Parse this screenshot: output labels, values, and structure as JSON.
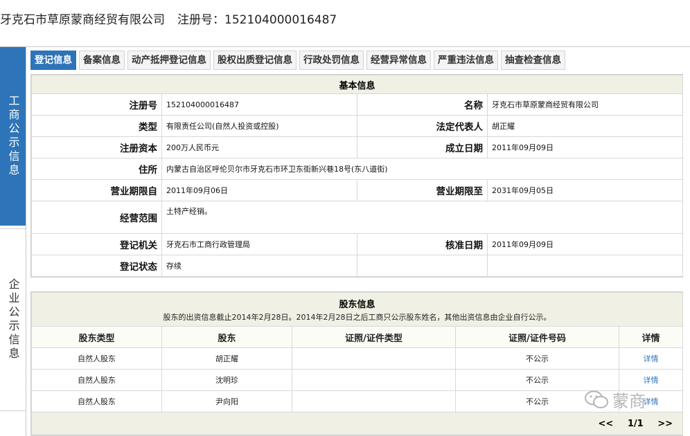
{
  "header": {
    "company": "牙克石市草原蒙商经贸有限公司",
    "reg_label": "注册号：",
    "reg_number": "152104000016487"
  },
  "side_tabs": [
    {
      "label": "工商公示信息",
      "active": true
    },
    {
      "label": "企业公示信息",
      "active": false
    }
  ],
  "tabs": [
    {
      "label": "登记信息",
      "active": true
    },
    {
      "label": "备案信息"
    },
    {
      "label": "动产抵押登记信息"
    },
    {
      "label": "股权出质登记信息"
    },
    {
      "label": "行政处罚信息"
    },
    {
      "label": "经营异常信息"
    },
    {
      "label": "严重违法信息"
    },
    {
      "label": "抽查检查信息"
    }
  ],
  "basic": {
    "title": "基本信息",
    "reg_no_label": "注册号",
    "reg_no": "152104000016487",
    "name_label": "名称",
    "name": "牙克石市草原蒙商经贸有限公司",
    "type_label": "类型",
    "type": "有限责任公司(自然人投资或控股)",
    "legal_label": "法定代表人",
    "legal": "胡正耀",
    "capital_label": "注册资本",
    "capital": "200万人民币元",
    "established_label": "成立日期",
    "established": "2011年09月09日",
    "address_label": "住所",
    "address": "内蒙古自治区呼伦贝尔市牙克石市环卫东街新兴巷18号(东八道街)",
    "from_label": "营业期限自",
    "from": "2011年09月06日",
    "to_label": "营业期限至",
    "to": "2031年09月05日",
    "scope_label": "经营范围",
    "scope": "土特产经销。",
    "authority_label": "登记机关",
    "authority": "牙克石市工商行政管理局",
    "approval_label": "核准日期",
    "approval": "2011年09月09日",
    "status_label": "登记状态",
    "status": "存续"
  },
  "shareholders": {
    "title": "股东信息",
    "note": "股东的出资信息截止2014年2月28日。2014年2月28日之后工商只公示股东姓名，其他出资信息由企业自行公示。",
    "columns": [
      "股东类型",
      "股东",
      "证照/证件类型",
      "证照/证件号码",
      "详情"
    ],
    "rows": [
      {
        "type": "自然人股东",
        "name": "胡正耀",
        "id_type": "",
        "id_no": "不公示",
        "detail": "详情"
      },
      {
        "type": "自然人股东",
        "name": "沈明珍",
        "id_type": "",
        "id_no": "不公示",
        "detail": "详情"
      },
      {
        "type": "自然人股东",
        "name": "尹向阳",
        "id_type": "",
        "id_no": "不公示",
        "detail": "详情"
      }
    ],
    "pager": {
      "prev": "<<",
      "page": "1/1",
      "next": ">>"
    }
  },
  "watermark": {
    "text": "蒙商",
    "icon": "wechat-icon"
  }
}
